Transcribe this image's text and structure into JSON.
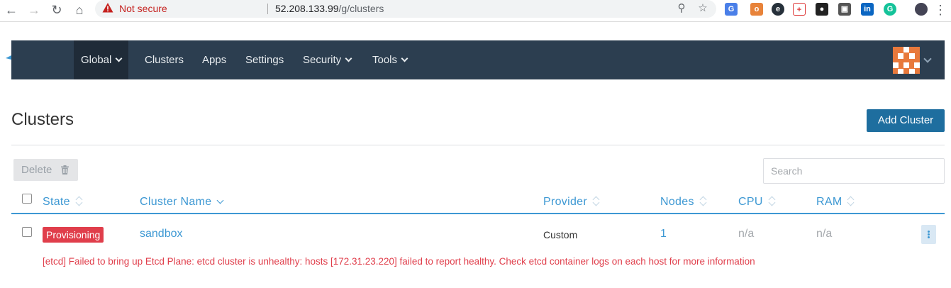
{
  "browser": {
    "security_label": "Not secure",
    "url_host": "52.208.133.99",
    "url_path": "/g/clusters"
  },
  "nav": {
    "items": [
      {
        "label": "Global",
        "dropdown": true,
        "active": true
      },
      {
        "label": "Clusters",
        "dropdown": false
      },
      {
        "label": "Apps",
        "dropdown": false
      },
      {
        "label": "Settings",
        "dropdown": false
      },
      {
        "label": "Security",
        "dropdown": true
      },
      {
        "label": "Tools",
        "dropdown": true
      }
    ]
  },
  "page": {
    "title": "Clusters",
    "add_button": "Add Cluster",
    "delete_button": "Delete",
    "search_placeholder": "Search"
  },
  "table": {
    "columns": [
      "State",
      "Cluster Name",
      "Provider",
      "Nodes",
      "CPU",
      "RAM"
    ],
    "rows": [
      {
        "state": "Provisioning",
        "name": "sandbox",
        "provider": "Custom",
        "nodes": "1",
        "cpu": "n/a",
        "ram": "n/a",
        "message": "[etcd] Failed to bring up Etcd Plane: etcd cluster is unhealthy: hosts [172.31.23.220] failed to report healthy. Check etcd container logs on each host for more information"
      }
    ]
  },
  "colors": {
    "header_bg": "#2c3e50",
    "accent": "#3d98d3",
    "primary_button": "#1e6e9f",
    "error": "#e03e4b"
  }
}
